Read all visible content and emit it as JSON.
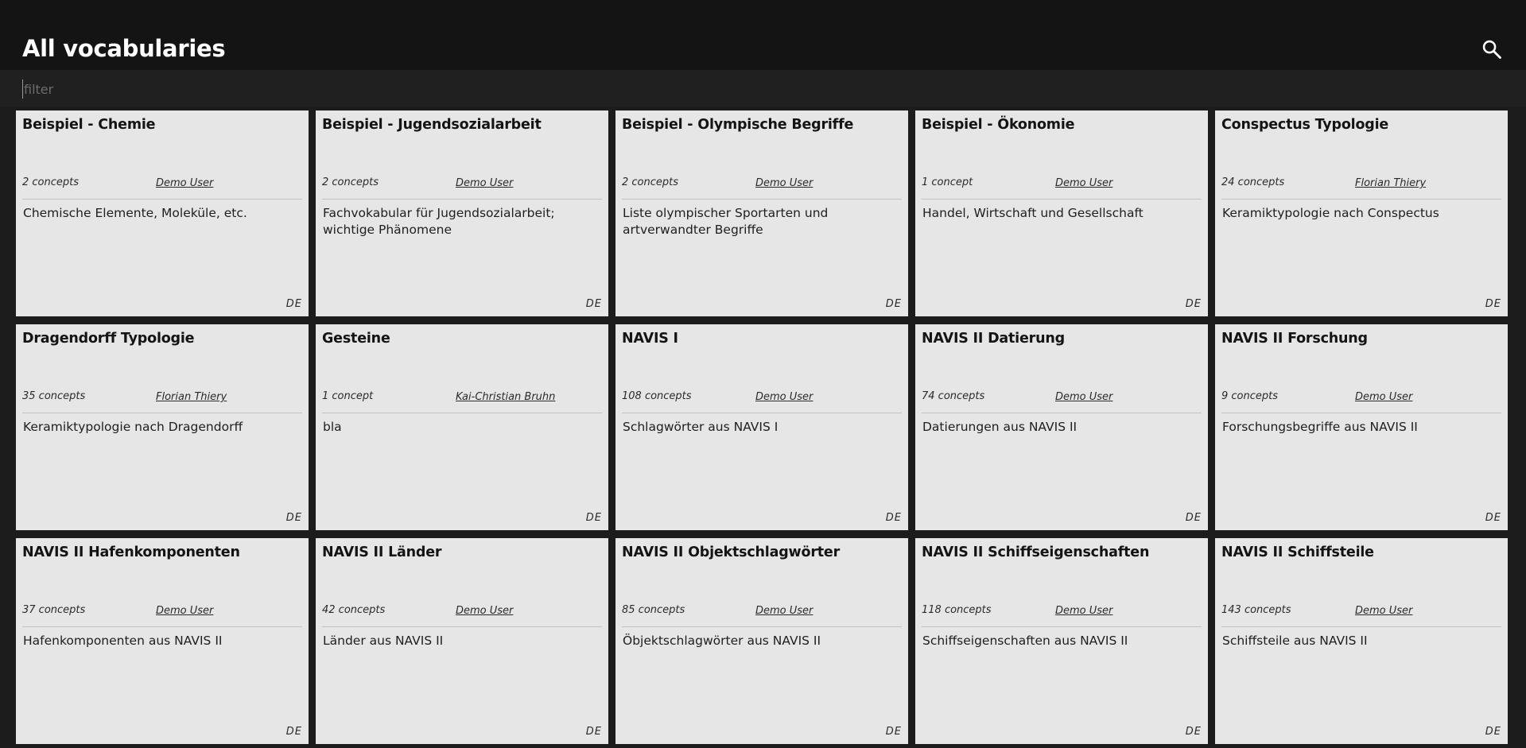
{
  "header": {
    "title": "All vocabularies",
    "search_icon": "search-icon"
  },
  "filter": {
    "placeholder": "filter",
    "value": ""
  },
  "vocabularies": [
    {
      "title": "Beispiel - Chemie",
      "concepts": "2 concepts",
      "author": "Demo User",
      "description": "Chemische Elemente, Moleküle, etc.",
      "language": "DE"
    },
    {
      "title": "Beispiel - Jugendsozialarbeit",
      "concepts": "2 concepts",
      "author": "Demo User",
      "description": "Fachvokabular für Jugendsozialarbeit; wichtige Phänomene",
      "language": "DE"
    },
    {
      "title": "Beispiel - Olympische Begriffe",
      "concepts": "2 concepts",
      "author": "Demo User",
      "description": "Liste olympischer Sportarten und artverwandter Begriffe",
      "language": "DE"
    },
    {
      "title": "Beispiel - Ökonomie",
      "concepts": "1 concept",
      "author": "Demo User",
      "description": "Handel, Wirtschaft und Gesellschaft",
      "language": "DE"
    },
    {
      "title": "Conspectus Typologie",
      "concepts": "24 concepts",
      "author": "Florian Thiery",
      "description": "Keramiktypologie nach Conspectus",
      "language": "DE"
    },
    {
      "title": "Dragendorff Typologie",
      "concepts": "35 concepts",
      "author": "Florian Thiery",
      "description": "Keramiktypologie nach Dragendorff",
      "language": "DE"
    },
    {
      "title": "Gesteine",
      "concepts": "1 concept",
      "author": "Kai-Christian Bruhn",
      "description": "bla",
      "language": "DE"
    },
    {
      "title": "NAVIS I",
      "concepts": "108 concepts",
      "author": "Demo User",
      "description": "Schlagwörter aus NAVIS I",
      "language": "DE"
    },
    {
      "title": "NAVIS II Datierung",
      "concepts": "74 concepts",
      "author": "Demo User",
      "description": "Datierungen aus NAVIS II",
      "language": "DE"
    },
    {
      "title": "NAVIS II Forschung",
      "concepts": "9 concepts",
      "author": "Demo User",
      "description": "Forschungsbegriffe aus NAVIS II",
      "language": "DE"
    },
    {
      "title": "NAVIS II Hafenkomponenten",
      "concepts": "37 concepts",
      "author": "Demo User",
      "description": "Hafenkomponenten aus NAVIS II",
      "language": "DE"
    },
    {
      "title": "NAVIS II Länder",
      "concepts": "42 concepts",
      "author": "Demo User",
      "description": "Länder aus NAVIS II",
      "language": "DE"
    },
    {
      "title": "NAVIS II Objektschlagwörter",
      "concepts": "85 concepts",
      "author": "Demo User",
      "description": "Öbjektschlagwörter aus NAVIS II",
      "language": "DE"
    },
    {
      "title": "NAVIS II Schiffseigenschaften",
      "concepts": "118 concepts",
      "author": "Demo User",
      "description": "Schiffseigenschaften aus NAVIS II",
      "language": "DE"
    },
    {
      "title": "NAVIS II Schiffsteile",
      "concepts": "143 concepts",
      "author": "Demo User",
      "description": "Schiffsteile aus NAVIS II",
      "language": "DE"
    }
  ]
}
